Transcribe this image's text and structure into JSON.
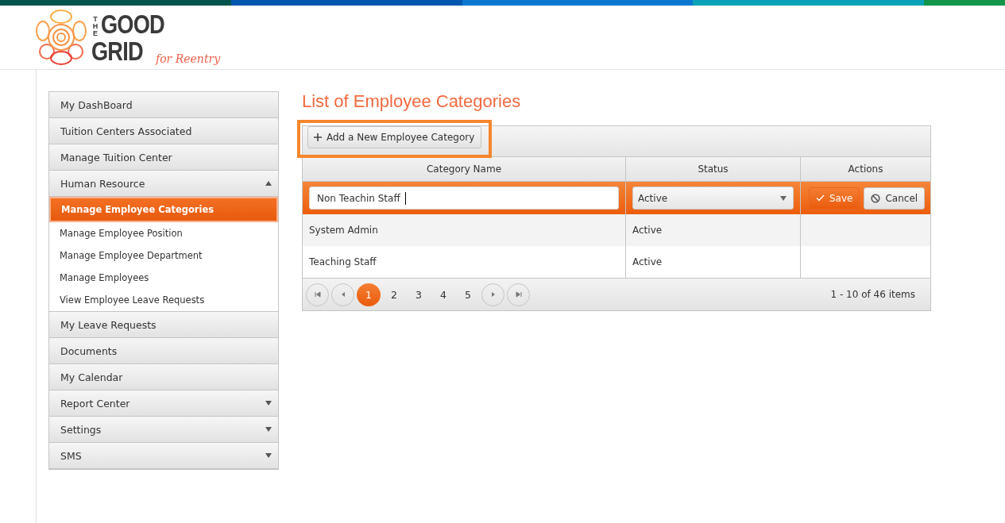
{
  "logo": {
    "top": "THE",
    "word1": "GOOD",
    "word2": "GRID",
    "tagline": "for Reentry"
  },
  "sidebar": {
    "items": [
      {
        "label": "My DashBoard",
        "kind": "link"
      },
      {
        "label": "Tuition Centers Associated",
        "kind": "link"
      },
      {
        "label": "Manage Tuition Center",
        "kind": "link"
      },
      {
        "label": "Human Resource",
        "kind": "group",
        "expanded": true,
        "children": [
          {
            "label": "Manage Employee Categories",
            "selected": true
          },
          {
            "label": "Manage Employee Position",
            "selected": false
          },
          {
            "label": "Manage Employee Department",
            "selected": false
          },
          {
            "label": "Manage Employees",
            "selected": false
          },
          {
            "label": "View Employee Leave Requests",
            "selected": false
          }
        ]
      },
      {
        "label": "My Leave Requests",
        "kind": "link"
      },
      {
        "label": "Documents",
        "kind": "link"
      },
      {
        "label": "My Calendar",
        "kind": "link"
      },
      {
        "label": "Report Center",
        "kind": "group",
        "expanded": false
      },
      {
        "label": "Settings",
        "kind": "group",
        "expanded": false
      },
      {
        "label": "SMS",
        "kind": "group",
        "expanded": false
      }
    ]
  },
  "page_title": "List of Employee Categories",
  "toolbar": {
    "add_button": "Add a New Employee Category"
  },
  "table": {
    "columns": [
      "Category Name",
      "Status",
      "Actions"
    ],
    "edit_row": {
      "value": "Non Teachin Staff",
      "status": "Active",
      "save": "Save",
      "cancel": "Cancel"
    },
    "rows": [
      {
        "name": "System Admin",
        "status": "Active"
      },
      {
        "name": "Teaching Staff",
        "status": "Active"
      }
    ]
  },
  "pager": {
    "pages": [
      {
        "label": "1",
        "selected": true
      },
      {
        "label": "2",
        "selected": false
      },
      {
        "label": "3",
        "selected": false
      },
      {
        "label": "4",
        "selected": false
      },
      {
        "label": "5",
        "selected": false
      }
    ],
    "info": "1 - 10 of 46 items"
  }
}
